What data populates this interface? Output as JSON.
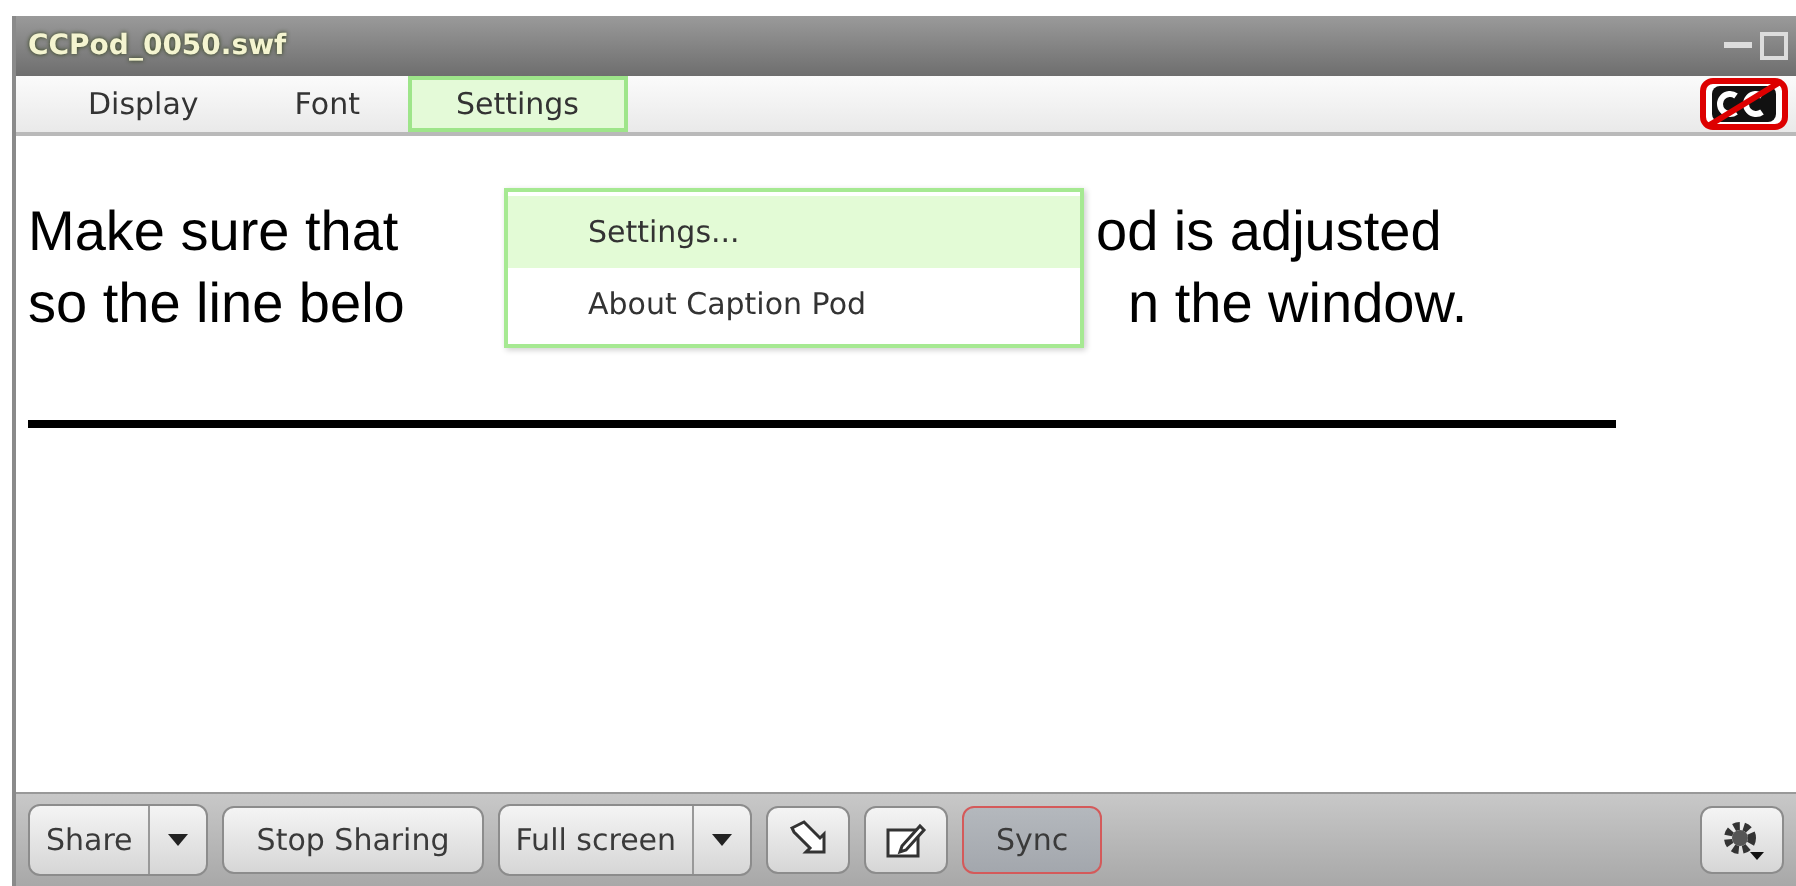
{
  "window": {
    "title": "CCPod_0050.swf"
  },
  "menu": [
    {
      "label": "Display",
      "selected": false
    },
    {
      "label": "Font",
      "selected": false
    },
    {
      "label": "Settings",
      "selected": true
    }
  ],
  "dropdown": [
    {
      "label": "Settings...",
      "selected": true
    },
    {
      "label": "About Caption Pod",
      "selected": false
    }
  ],
  "caption_lines": [
    {
      "left": "Make sure that",
      "right": "od is adjusted"
    },
    {
      "left": "so the line belo",
      "right": "n the window."
    }
  ],
  "toolbar": [
    {
      "kind": "split",
      "label": "Share"
    },
    {
      "kind": "button",
      "label": "Stop Sharing"
    },
    {
      "kind": "split",
      "label": "Full screen"
    },
    {
      "kind": "pointer"
    },
    {
      "kind": "annotate"
    },
    {
      "kind": "toggle",
      "label": "Sync",
      "on": true
    }
  ]
}
